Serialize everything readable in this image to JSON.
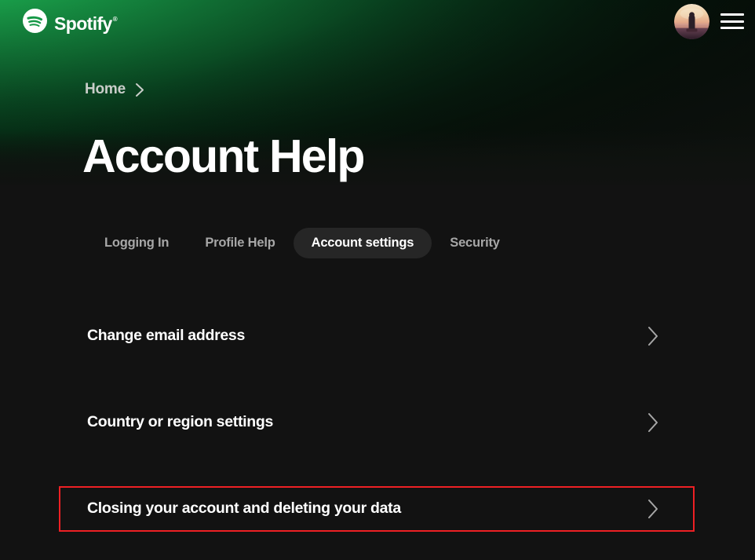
{
  "brand": {
    "name": "Spotify",
    "registered_mark": "®",
    "logo_icon": "spotify-logo-icon"
  },
  "topbar": {
    "avatar_icon": "user-avatar-photo",
    "menu_icon": "hamburger-menu-icon"
  },
  "breadcrumb": {
    "items": [
      {
        "label": "Home"
      }
    ],
    "separator_icon": "chevron-right-icon"
  },
  "header": {
    "title": "Account Help"
  },
  "tabs": {
    "active": "Account settings",
    "items": [
      {
        "label": "Logging In",
        "active": false
      },
      {
        "label": "Profile Help",
        "active": false
      },
      {
        "label": "Account settings",
        "active": true
      },
      {
        "label": "Security",
        "active": false
      }
    ]
  },
  "help_list": {
    "chevron_icon": "chevron-right-icon",
    "items": [
      {
        "label": "Change email address",
        "highlighted": false
      },
      {
        "label": "Country or region settings",
        "highlighted": false
      },
      {
        "label": "Closing your account and deleting your data",
        "highlighted": true
      }
    ]
  },
  "colors": {
    "brand_green": "#1db954",
    "hero_green_top": "#1fb254",
    "page_background": "#121212",
    "active_tab_background": "#262626",
    "inactive_tab_text": "#a7a7a7",
    "highlight_border": "#ed2024",
    "chevron_grey": "#a7a7a7",
    "text_white": "#ffffff"
  }
}
